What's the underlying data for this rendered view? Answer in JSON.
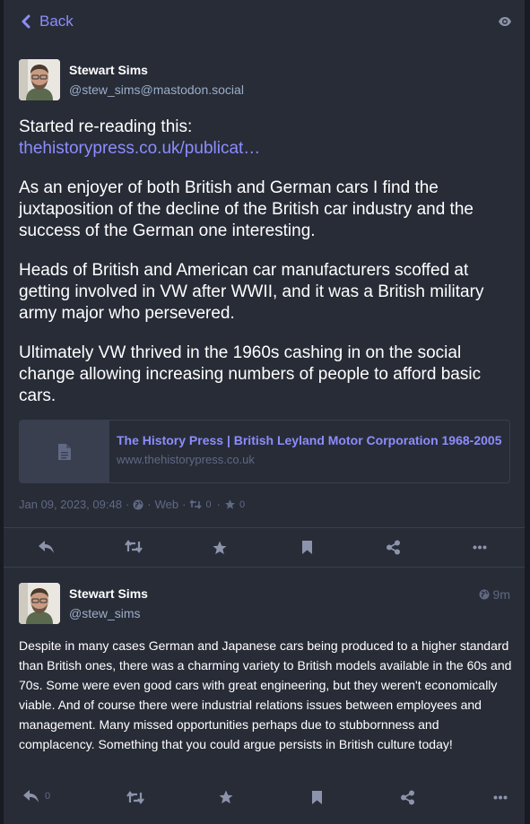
{
  "header": {
    "back_label": "Back"
  },
  "main_status": {
    "display_name": "Stewart Sims",
    "account": "@stew_sims@mastodon.social",
    "content": {
      "intro": "Started re-reading this:",
      "link": "thehistorypress.co.uk/publicat…",
      "p1": "As an enjoyer of both British and German cars I find the juxtaposition of the decline of the British car industry and the success of the German one interesting.",
      "p2": "Heads of British and American car manufacturers scoffed at getting involved in VW after WWII, and it was a British military army major who persevered.",
      "p3": "Ultimately VW thrived in the 1960s cashing in on the social change allowing increasing numbers of people to afford basic cars."
    },
    "card": {
      "title": "The History Press | British Leyland Motor Corporation 1968-2005",
      "host": "www.thehistorypress.co.uk"
    },
    "meta": {
      "date": "Jan 09, 2023, 09:48",
      "sep": "·",
      "app": "Web",
      "boosts": "0",
      "favourites": "0"
    }
  },
  "reply_status": {
    "display_name": "Stewart Sims",
    "account": "@stew_sims",
    "time": "9m",
    "content": "Despite in many cases German and Japanese cars being produced to a higher standard than British ones, there was a charming variety to British models available in the 60s and 70s. Some were even good cars with great engineering, but they weren't economically viable. And of course there were industrial relations issues between employees and management. Many missed opportunities perhaps due to stubbornness and complacency. Something that you could argue persists in British culture today!",
    "reply_count": "0"
  },
  "colors": {
    "background": "#282c37",
    "accent": "#8c8dff",
    "muted": "#606984",
    "icon": "#8c93ab"
  },
  "icons": [
    "chevron-left-icon",
    "eye-icon",
    "file-icon",
    "globe-icon",
    "retweet-icon",
    "star-icon",
    "reply-icon",
    "bookmark-icon",
    "share-icon",
    "ellipsis-icon"
  ]
}
